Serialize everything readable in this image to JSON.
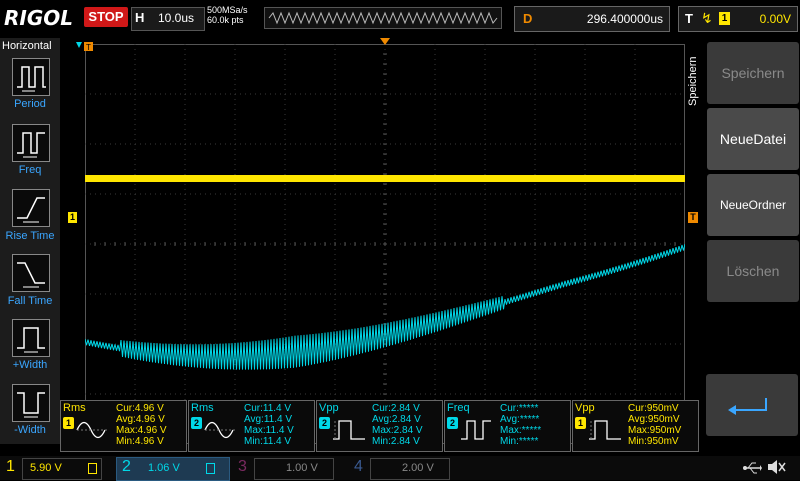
{
  "brand": "RIGOL",
  "run_state": "STOP",
  "timebase": {
    "key": "H",
    "value": "10.0us"
  },
  "sampling": {
    "rate": "500MSa/s",
    "points": "60.0k pts"
  },
  "delay": {
    "key": "D",
    "value": "296.400000us"
  },
  "trigger": {
    "key": "T",
    "edge_icon": "rising-edge-icon",
    "channel": "1",
    "level": "0.00V"
  },
  "left_menu": {
    "title": "Horizontal",
    "items": [
      {
        "label": "Period",
        "icon": "period-icon"
      },
      {
        "label": "Freq",
        "icon": "freq-icon"
      },
      {
        "label": "Rise Time",
        "icon": "rise-time-icon"
      },
      {
        "label": "Fall Time",
        "icon": "fall-time-icon"
      },
      {
        "label": "+Width",
        "icon": "pos-width-icon"
      },
      {
        "label": "-Width",
        "icon": "neg-width-icon"
      }
    ]
  },
  "right_menu": {
    "title": "Speichern",
    "items": [
      {
        "label": "Speichern",
        "enabled": false
      },
      {
        "label": "NeueDatei",
        "enabled": true
      },
      {
        "label": "NeueOrdner",
        "enabled": true
      },
      {
        "label": "Löschen",
        "enabled": false
      }
    ],
    "return_icon": "return-arrow-icon"
  },
  "markers": {
    "ch1": "1",
    "trigger_flag": "T"
  },
  "measurements": [
    {
      "name": "Rms",
      "channel": "1",
      "cur": "Cur:4.96 V",
      "avg": "Avg:4.96 V",
      "max": "Max:4.96 V",
      "min": "Min:4.96 V",
      "color": "#ffe600",
      "icon": "sine-wave-icon"
    },
    {
      "name": "Rms",
      "channel": "2",
      "cur": "Cur:11.4 V",
      "avg": "Avg:11.4 V",
      "max": "Max:11.4 V",
      "min": "Min:11.4 V",
      "color": "#00d8e8",
      "icon": "sine-wave-icon"
    },
    {
      "name": "Vpp",
      "channel": "2",
      "cur": "Cur:2.84 V",
      "avg": "Avg:2.84 V",
      "max": "Max:2.84 V",
      "min": "Min:2.84 V",
      "color": "#00d8e8",
      "icon": "vpp-pulse-icon"
    },
    {
      "name": "Freq",
      "channel": "2",
      "cur": "Cur:*****",
      "avg": "Avg:*****",
      "max": "Max:*****",
      "min": "Min:*****",
      "color": "#00d8e8",
      "icon": "freq-pulse-icon"
    },
    {
      "name": "Vpp",
      "channel": "1",
      "cur": "Cur:950mV",
      "avg": "Avg:950mV",
      "max": "Max:950mV",
      "min": "Min:950mV",
      "color": "#ffe600",
      "icon": "vpp-pulse-icon"
    }
  ],
  "channels": [
    {
      "num": "1",
      "scale": "5.90 V",
      "color": "#ffe600",
      "active": false
    },
    {
      "num": "2",
      "scale": "1.06 V",
      "color": "#00d8e8",
      "active": true
    },
    {
      "num": "3",
      "scale": "1.00 V",
      "color": "#c040a0",
      "active": false
    },
    {
      "num": "4",
      "scale": "2.00 V",
      "color": "#4a7ac8",
      "active": false
    }
  ],
  "status_icons": [
    "usb-icon",
    "mute-speaker-icon"
  ],
  "colors": {
    "ch1": "#ffe600",
    "ch2": "#00d8e8",
    "trigger_marker": "#f08a00",
    "stop": "#d01818"
  }
}
